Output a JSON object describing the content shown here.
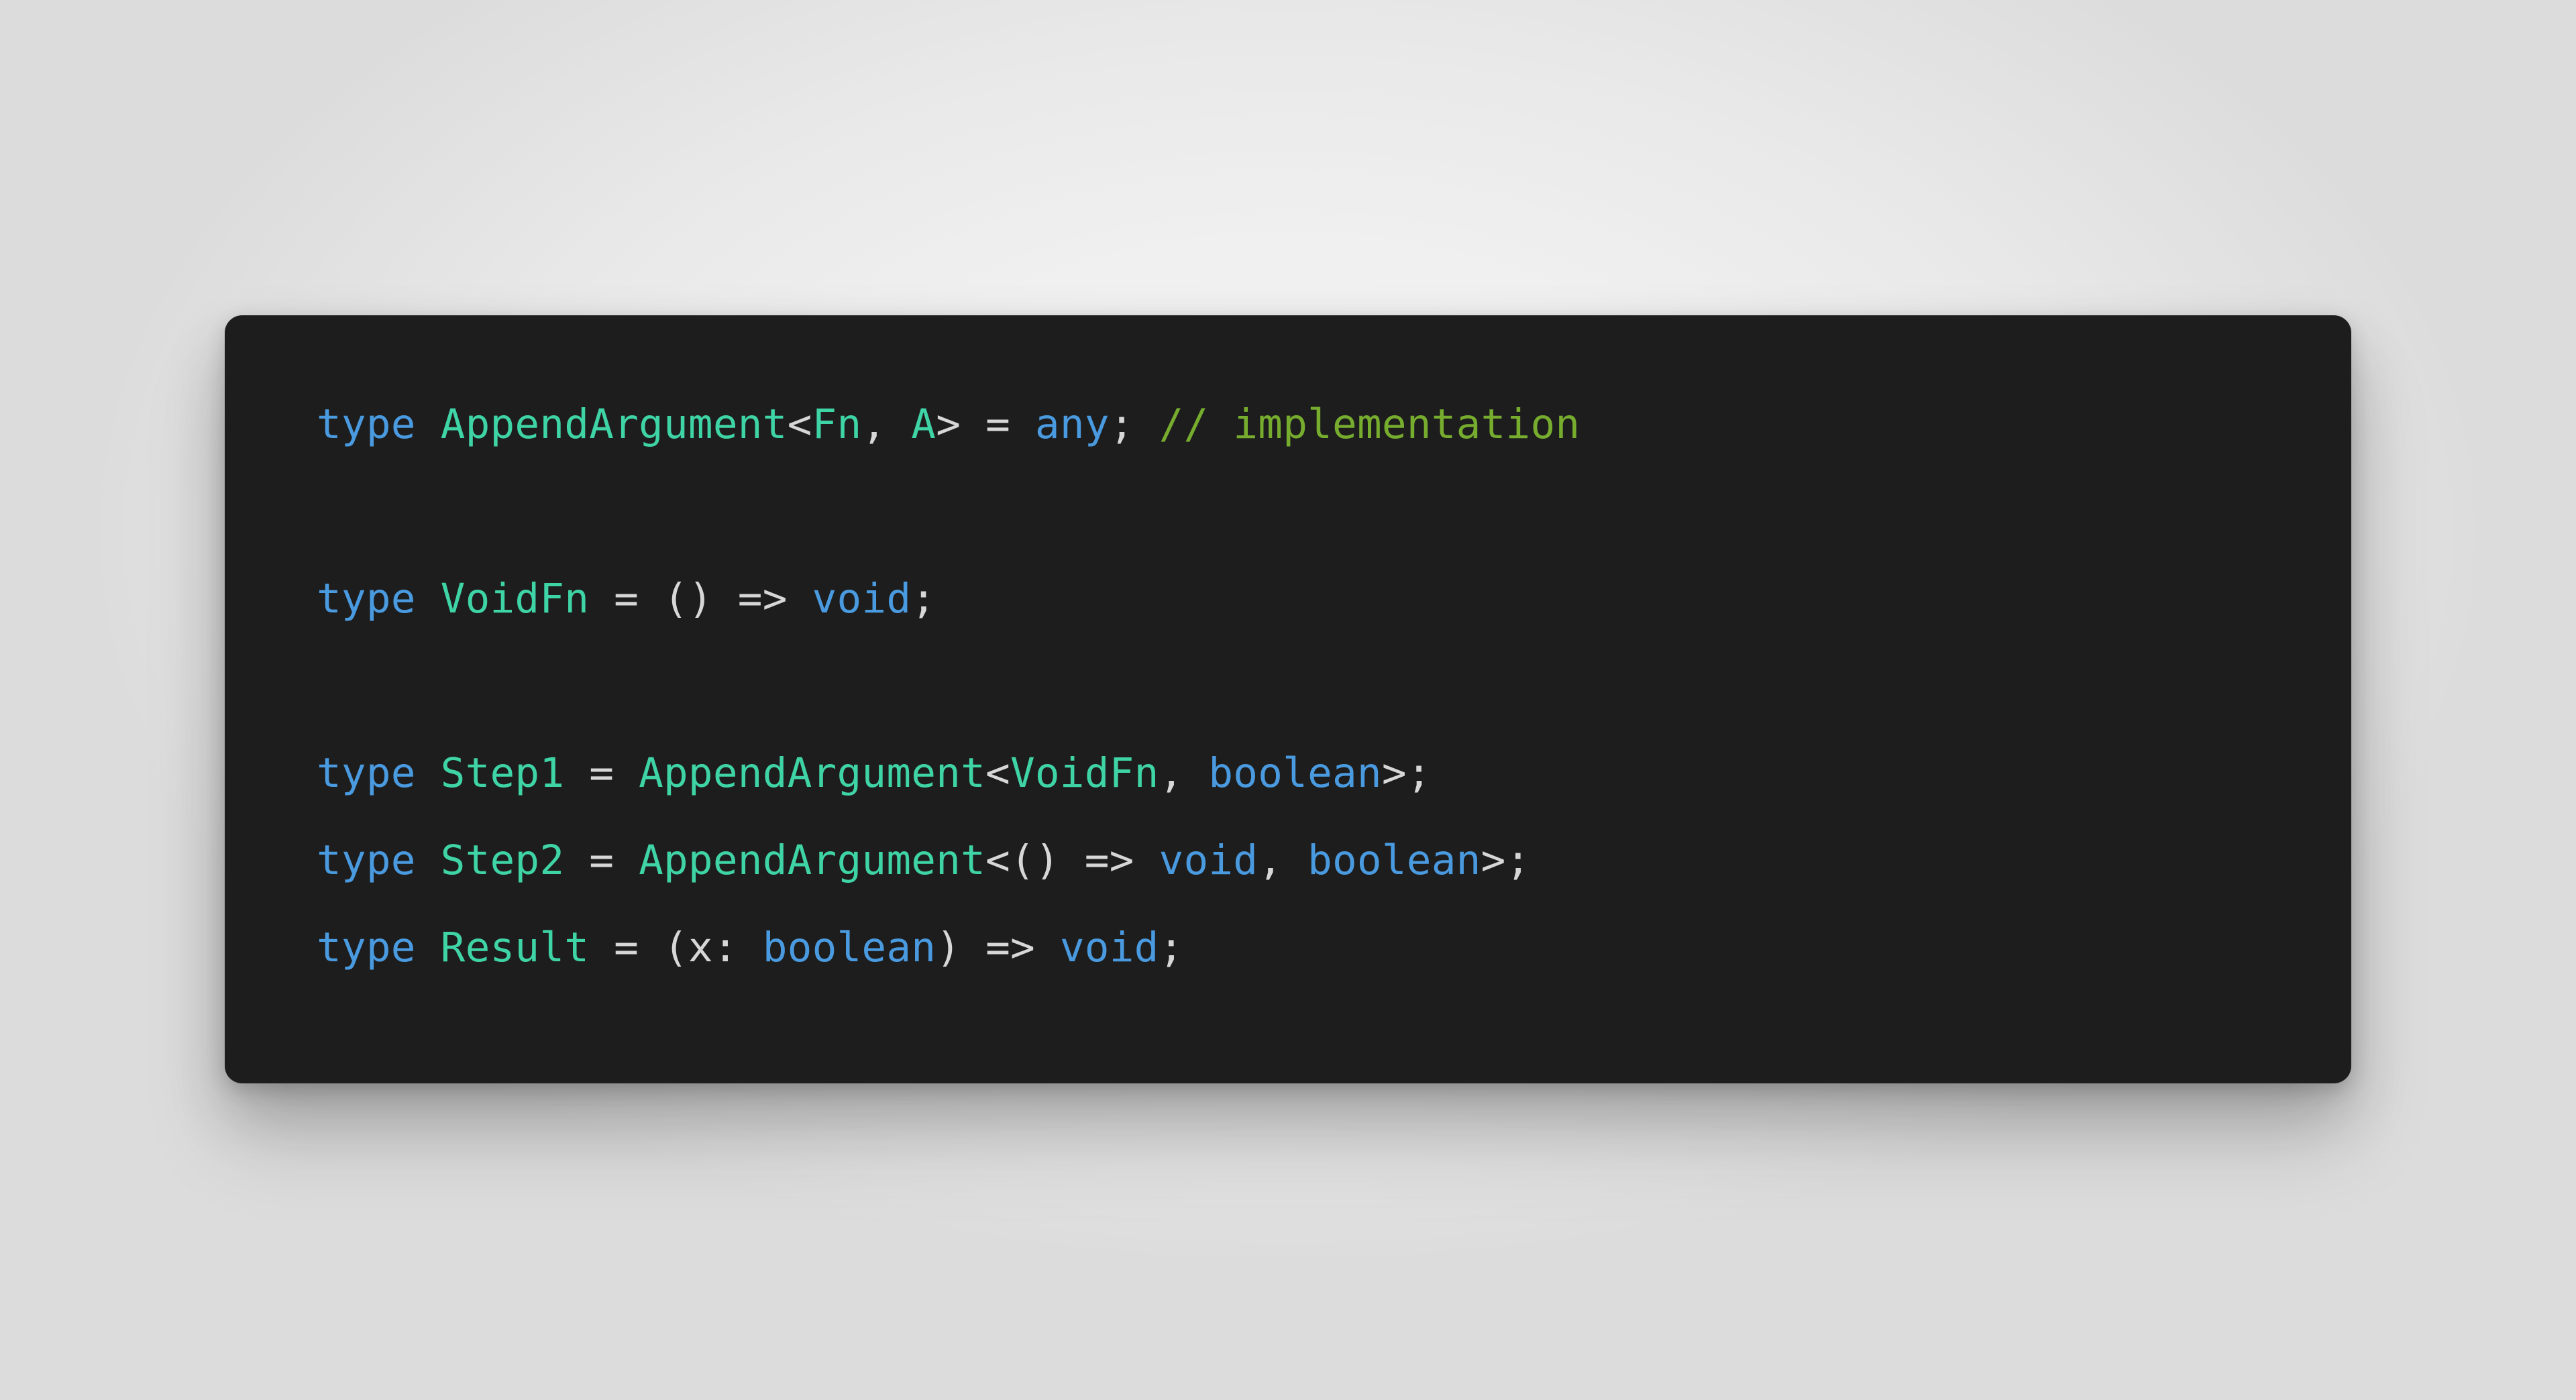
{
  "page": {
    "background_color": "#f0f0f0",
    "card_background_color": "#1d1d1d"
  },
  "theme": {
    "keyword_color": "#4a9ae0",
    "type_color": "#3fd4a5",
    "primitive_color": "#4a9ae0",
    "punctuation_color": "#d7d7d7",
    "comment_color": "#77ad2e"
  },
  "code": {
    "language": "typescript",
    "full_text": "type AppendArgument<Fn, A> = any; // implementation\n\ntype VoidFn = () => void;\n\ntype Step1 = AppendArgument<VoidFn, boolean>;\ntype Step2 = AppendArgument<() => void, boolean>;\ntype Result = (x: boolean) => void;",
    "lines": [
      {
        "index": 1,
        "text": "type AppendArgument<Fn, A> = any; // implementation",
        "tokens": {
          "kw": "type",
          "type_name": "AppendArgument",
          "open_angle": "<",
          "generic_1": "Fn",
          "comma_1": ",",
          "generic_2": "A",
          "close_angle": ">",
          "equals": " = ",
          "primitive": "any",
          "semicolon": ";",
          "comment": "// implementation"
        }
      },
      {
        "index": 2,
        "text": ""
      },
      {
        "index": 3,
        "text": "type VoidFn = () => void;",
        "tokens": {
          "kw": "type",
          "type_name": "VoidFn",
          "equals": " = ",
          "parens": "()",
          "arrow": " => ",
          "primitive": "void",
          "semicolon": ";"
        }
      },
      {
        "index": 4,
        "text": ""
      },
      {
        "index": 5,
        "text": "type Step1 = AppendArgument<VoidFn, boolean>;",
        "tokens": {
          "kw": "type",
          "type_name": "Step1",
          "equals": " = ",
          "generic_type": "AppendArgument",
          "open_angle": "<",
          "arg_1": "VoidFn",
          "comma": ", ",
          "arg_2": "boolean",
          "close_angle": ">",
          "semicolon": ";"
        }
      },
      {
        "index": 6,
        "text": "type Step2 = AppendArgument<() => void, boolean>;",
        "tokens": {
          "kw": "type",
          "type_name": "Step2",
          "equals": " = ",
          "generic_type": "AppendArgument",
          "open_angle": "<",
          "parens": "()",
          "arrow": " => ",
          "arg_1": "void",
          "comma": ", ",
          "arg_2": "boolean",
          "close_angle": ">",
          "semicolon": ";"
        }
      },
      {
        "index": 7,
        "text": "type Result = (x: boolean) => void;",
        "tokens": {
          "kw": "type",
          "type_name": "Result",
          "equals": " = ",
          "open_paren": "(",
          "param_name": "x",
          "colon": ": ",
          "param_type": "boolean",
          "close_paren": ")",
          "arrow": " => ",
          "return_type": "void",
          "semicolon": ";"
        }
      }
    ]
  }
}
